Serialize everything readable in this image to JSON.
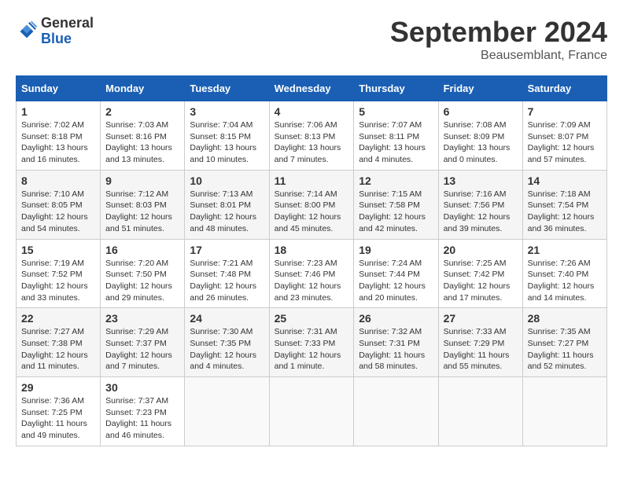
{
  "header": {
    "logo": {
      "general": "General",
      "blue": "Blue"
    },
    "title": "September 2024",
    "subtitle": "Beausemblant, France"
  },
  "calendar": {
    "columns": [
      "Sunday",
      "Monday",
      "Tuesday",
      "Wednesday",
      "Thursday",
      "Friday",
      "Saturday"
    ],
    "weeks": [
      [
        null,
        null,
        null,
        null,
        null,
        null,
        null
      ]
    ],
    "days": {
      "1": {
        "sunrise": "7:02 AM",
        "sunset": "8:18 PM",
        "daylight": "13 hours and 16 minutes"
      },
      "2": {
        "sunrise": "7:03 AM",
        "sunset": "8:16 PM",
        "daylight": "13 hours and 13 minutes"
      },
      "3": {
        "sunrise": "7:04 AM",
        "sunset": "8:15 PM",
        "daylight": "13 hours and 10 minutes"
      },
      "4": {
        "sunrise": "7:06 AM",
        "sunset": "8:13 PM",
        "daylight": "13 hours and 7 minutes"
      },
      "5": {
        "sunrise": "7:07 AM",
        "sunset": "8:11 PM",
        "daylight": "13 hours and 4 minutes"
      },
      "6": {
        "sunrise": "7:08 AM",
        "sunset": "8:09 PM",
        "daylight": "13 hours and 0 minutes"
      },
      "7": {
        "sunrise": "7:09 AM",
        "sunset": "8:07 PM",
        "daylight": "12 hours and 57 minutes"
      },
      "8": {
        "sunrise": "7:10 AM",
        "sunset": "8:05 PM",
        "daylight": "12 hours and 54 minutes"
      },
      "9": {
        "sunrise": "7:12 AM",
        "sunset": "8:03 PM",
        "daylight": "12 hours and 51 minutes"
      },
      "10": {
        "sunrise": "7:13 AM",
        "sunset": "8:01 PM",
        "daylight": "12 hours and 48 minutes"
      },
      "11": {
        "sunrise": "7:14 AM",
        "sunset": "8:00 PM",
        "daylight": "12 hours and 45 minutes"
      },
      "12": {
        "sunrise": "7:15 AM",
        "sunset": "7:58 PM",
        "daylight": "12 hours and 42 minutes"
      },
      "13": {
        "sunrise": "7:16 AM",
        "sunset": "7:56 PM",
        "daylight": "12 hours and 39 minutes"
      },
      "14": {
        "sunrise": "7:18 AM",
        "sunset": "7:54 PM",
        "daylight": "12 hours and 36 minutes"
      },
      "15": {
        "sunrise": "7:19 AM",
        "sunset": "7:52 PM",
        "daylight": "12 hours and 33 minutes"
      },
      "16": {
        "sunrise": "7:20 AM",
        "sunset": "7:50 PM",
        "daylight": "12 hours and 29 minutes"
      },
      "17": {
        "sunrise": "7:21 AM",
        "sunset": "7:48 PM",
        "daylight": "12 hours and 26 minutes"
      },
      "18": {
        "sunrise": "7:23 AM",
        "sunset": "7:46 PM",
        "daylight": "12 hours and 23 minutes"
      },
      "19": {
        "sunrise": "7:24 AM",
        "sunset": "7:44 PM",
        "daylight": "12 hours and 20 minutes"
      },
      "20": {
        "sunrise": "7:25 AM",
        "sunset": "7:42 PM",
        "daylight": "12 hours and 17 minutes"
      },
      "21": {
        "sunrise": "7:26 AM",
        "sunset": "7:40 PM",
        "daylight": "12 hours and 14 minutes"
      },
      "22": {
        "sunrise": "7:27 AM",
        "sunset": "7:38 PM",
        "daylight": "12 hours and 11 minutes"
      },
      "23": {
        "sunrise": "7:29 AM",
        "sunset": "7:37 PM",
        "daylight": "12 hours and 7 minutes"
      },
      "24": {
        "sunrise": "7:30 AM",
        "sunset": "7:35 PM",
        "daylight": "12 hours and 4 minutes"
      },
      "25": {
        "sunrise": "7:31 AM",
        "sunset": "7:33 PM",
        "daylight": "12 hours and 1 minute"
      },
      "26": {
        "sunrise": "7:32 AM",
        "sunset": "7:31 PM",
        "daylight": "11 hours and 58 minutes"
      },
      "27": {
        "sunrise": "7:33 AM",
        "sunset": "7:29 PM",
        "daylight": "11 hours and 55 minutes"
      },
      "28": {
        "sunrise": "7:35 AM",
        "sunset": "7:27 PM",
        "daylight": "11 hours and 52 minutes"
      },
      "29": {
        "sunrise": "7:36 AM",
        "sunset": "7:25 PM",
        "daylight": "11 hours and 49 minutes"
      },
      "30": {
        "sunrise": "7:37 AM",
        "sunset": "7:23 PM",
        "daylight": "11 hours and 46 minutes"
      }
    }
  }
}
